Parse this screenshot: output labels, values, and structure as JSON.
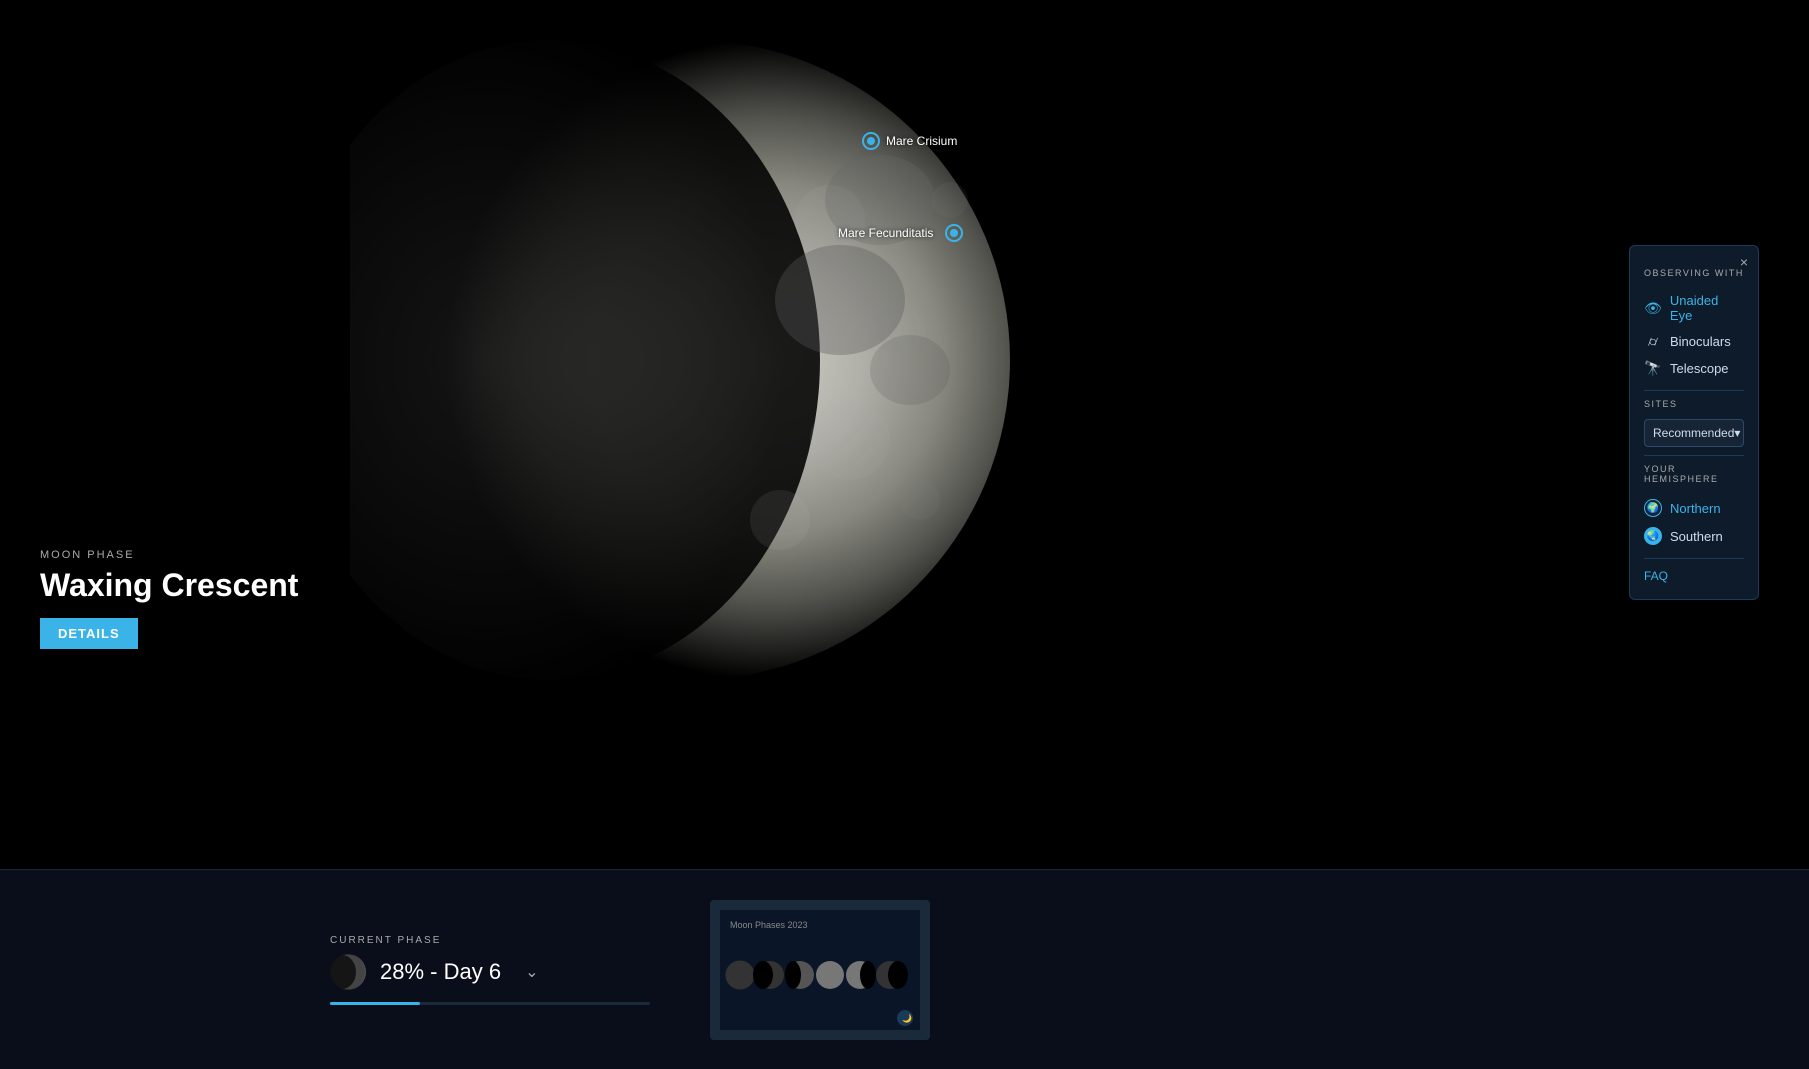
{
  "panel": {
    "title": "OBSERVING WITH",
    "close_label": "×",
    "options": [
      {
        "id": "unaided",
        "label": "Unaided Eye",
        "active": true,
        "icon": "👁"
      },
      {
        "id": "binoculars",
        "label": "Binoculars",
        "active": false,
        "icon": "🔭"
      },
      {
        "id": "telescope",
        "label": "Telescope",
        "active": false,
        "icon": "🔭"
      }
    ],
    "sites_section": "SITES",
    "sites_dropdown_label": "Recommended",
    "hemisphere_section": "YOUR HEMISPHERE",
    "hemispheres": [
      {
        "id": "northern",
        "label": "Northern",
        "active": true
      },
      {
        "id": "southern",
        "label": "Southern",
        "active": false
      }
    ],
    "faq_label": "FAQ"
  },
  "moon_phase": {
    "section_label": "MOON PHASE",
    "phase_name": "Waxing Crescent",
    "details_button": "DETAILS"
  },
  "bottom": {
    "current_phase_label": "CURRENT PHASE",
    "phase_percent": "28% - Day 6",
    "phase_bar_fill": 28
  },
  "mare_markers": [
    {
      "id": "crisium",
      "label": "Mare Crisium"
    },
    {
      "id": "fecunditatis",
      "label": "Mare Fecunditatis"
    }
  ],
  "moon_phases_card": {
    "title": "Moon Phases 2023"
  }
}
